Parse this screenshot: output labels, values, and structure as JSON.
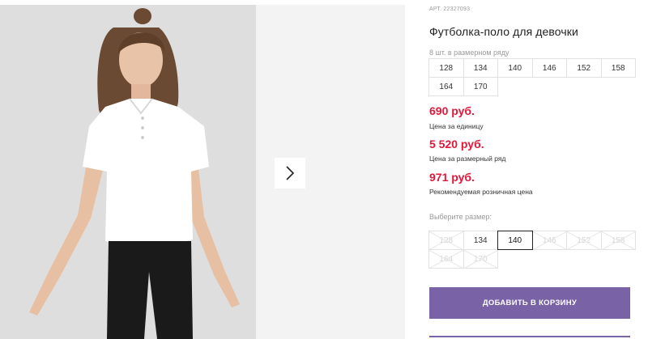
{
  "product": {
    "article": "АРТ. 22327093",
    "title": "Футболка-поло для девочки",
    "image_alt": "girl-in-white-polo"
  },
  "pack": {
    "label": "8 шт. в размерном ряду",
    "sizes": [
      "128",
      "134",
      "140",
      "146",
      "152",
      "158",
      "164",
      "170"
    ]
  },
  "prices": {
    "unit_price": "690 руб.",
    "unit_caption": "Цена за единицу",
    "row_price": "5 520 руб.",
    "row_caption": "Цена за размерный ряд",
    "retail_price": "971 руб.",
    "retail_caption": "Рекомендуемая розничная цена",
    "accent_color": "#e2173a"
  },
  "choose": {
    "label": "Выберите размер:",
    "selected": "140",
    "options": [
      {
        "size": "128",
        "state": "disabled"
      },
      {
        "size": "134",
        "state": "available"
      },
      {
        "size": "140",
        "state": "selected"
      },
      {
        "size": "146",
        "state": "disabled"
      },
      {
        "size": "152",
        "state": "disabled"
      },
      {
        "size": "158",
        "state": "disabled"
      },
      {
        "size": "164",
        "state": "disabled"
      },
      {
        "size": "170",
        "state": "disabled"
      }
    ]
  },
  "cart": {
    "add_label": "ДОБАВИТЬ В КОРЗИНУ",
    "button_color": "#7a62a6"
  },
  "gallery": {
    "next_icon": "chevron-right-icon"
  }
}
